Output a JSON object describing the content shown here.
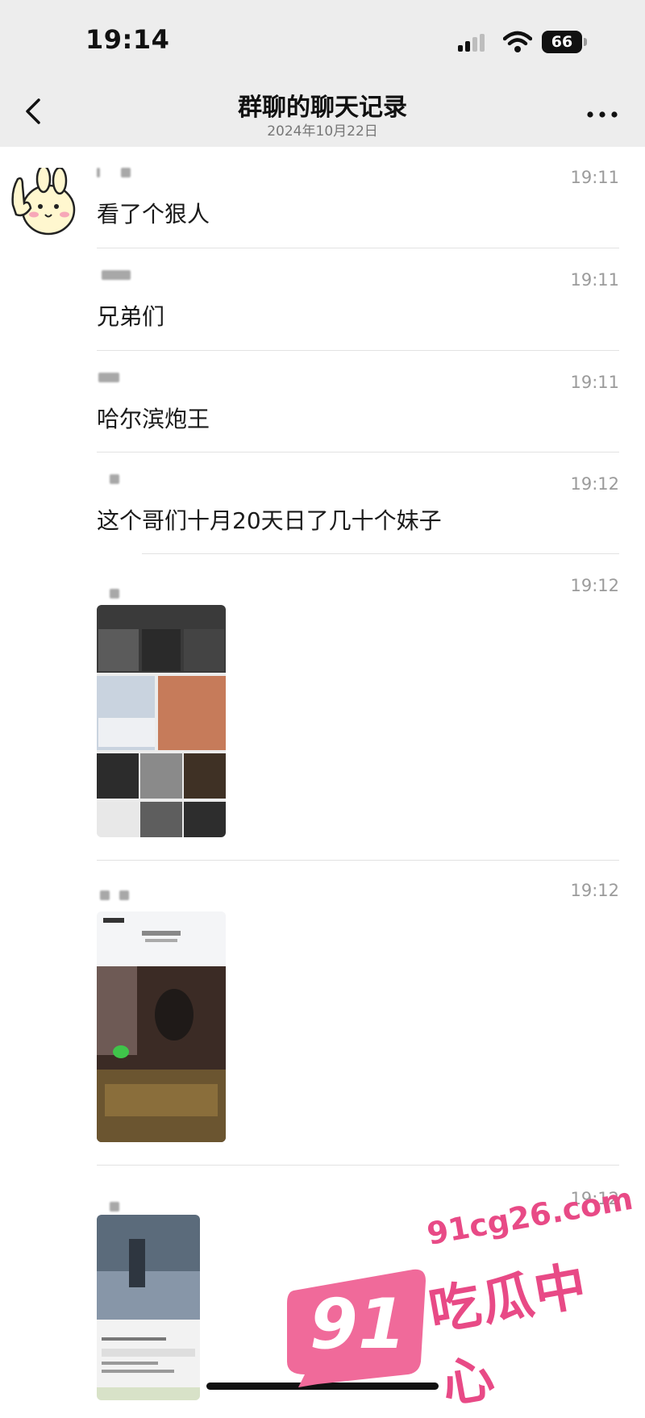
{
  "status_bar": {
    "time": "19:14",
    "battery": "66"
  },
  "nav": {
    "title": "群聊的聊天记录",
    "subtitle": "2024年10月22日"
  },
  "messages": [
    {
      "time": "19:11",
      "text": "看了个狠人"
    },
    {
      "time": "19:11",
      "text": "兄弟们"
    },
    {
      "time": "19:11",
      "text": "哈尔滨炮王"
    },
    {
      "time": "19:12",
      "text": "这个哥们十月20天日了几十个妹子"
    },
    {
      "time": "19:12",
      "image": "photo-collage"
    },
    {
      "time": "19:12",
      "image": "phone-screenshot-photo"
    },
    {
      "time": "19:12",
      "image": "phone-screenshot-photo"
    }
  ],
  "watermark": {
    "logo_number": "91",
    "url": "91cg26.com",
    "name": "吃瓜中心"
  }
}
